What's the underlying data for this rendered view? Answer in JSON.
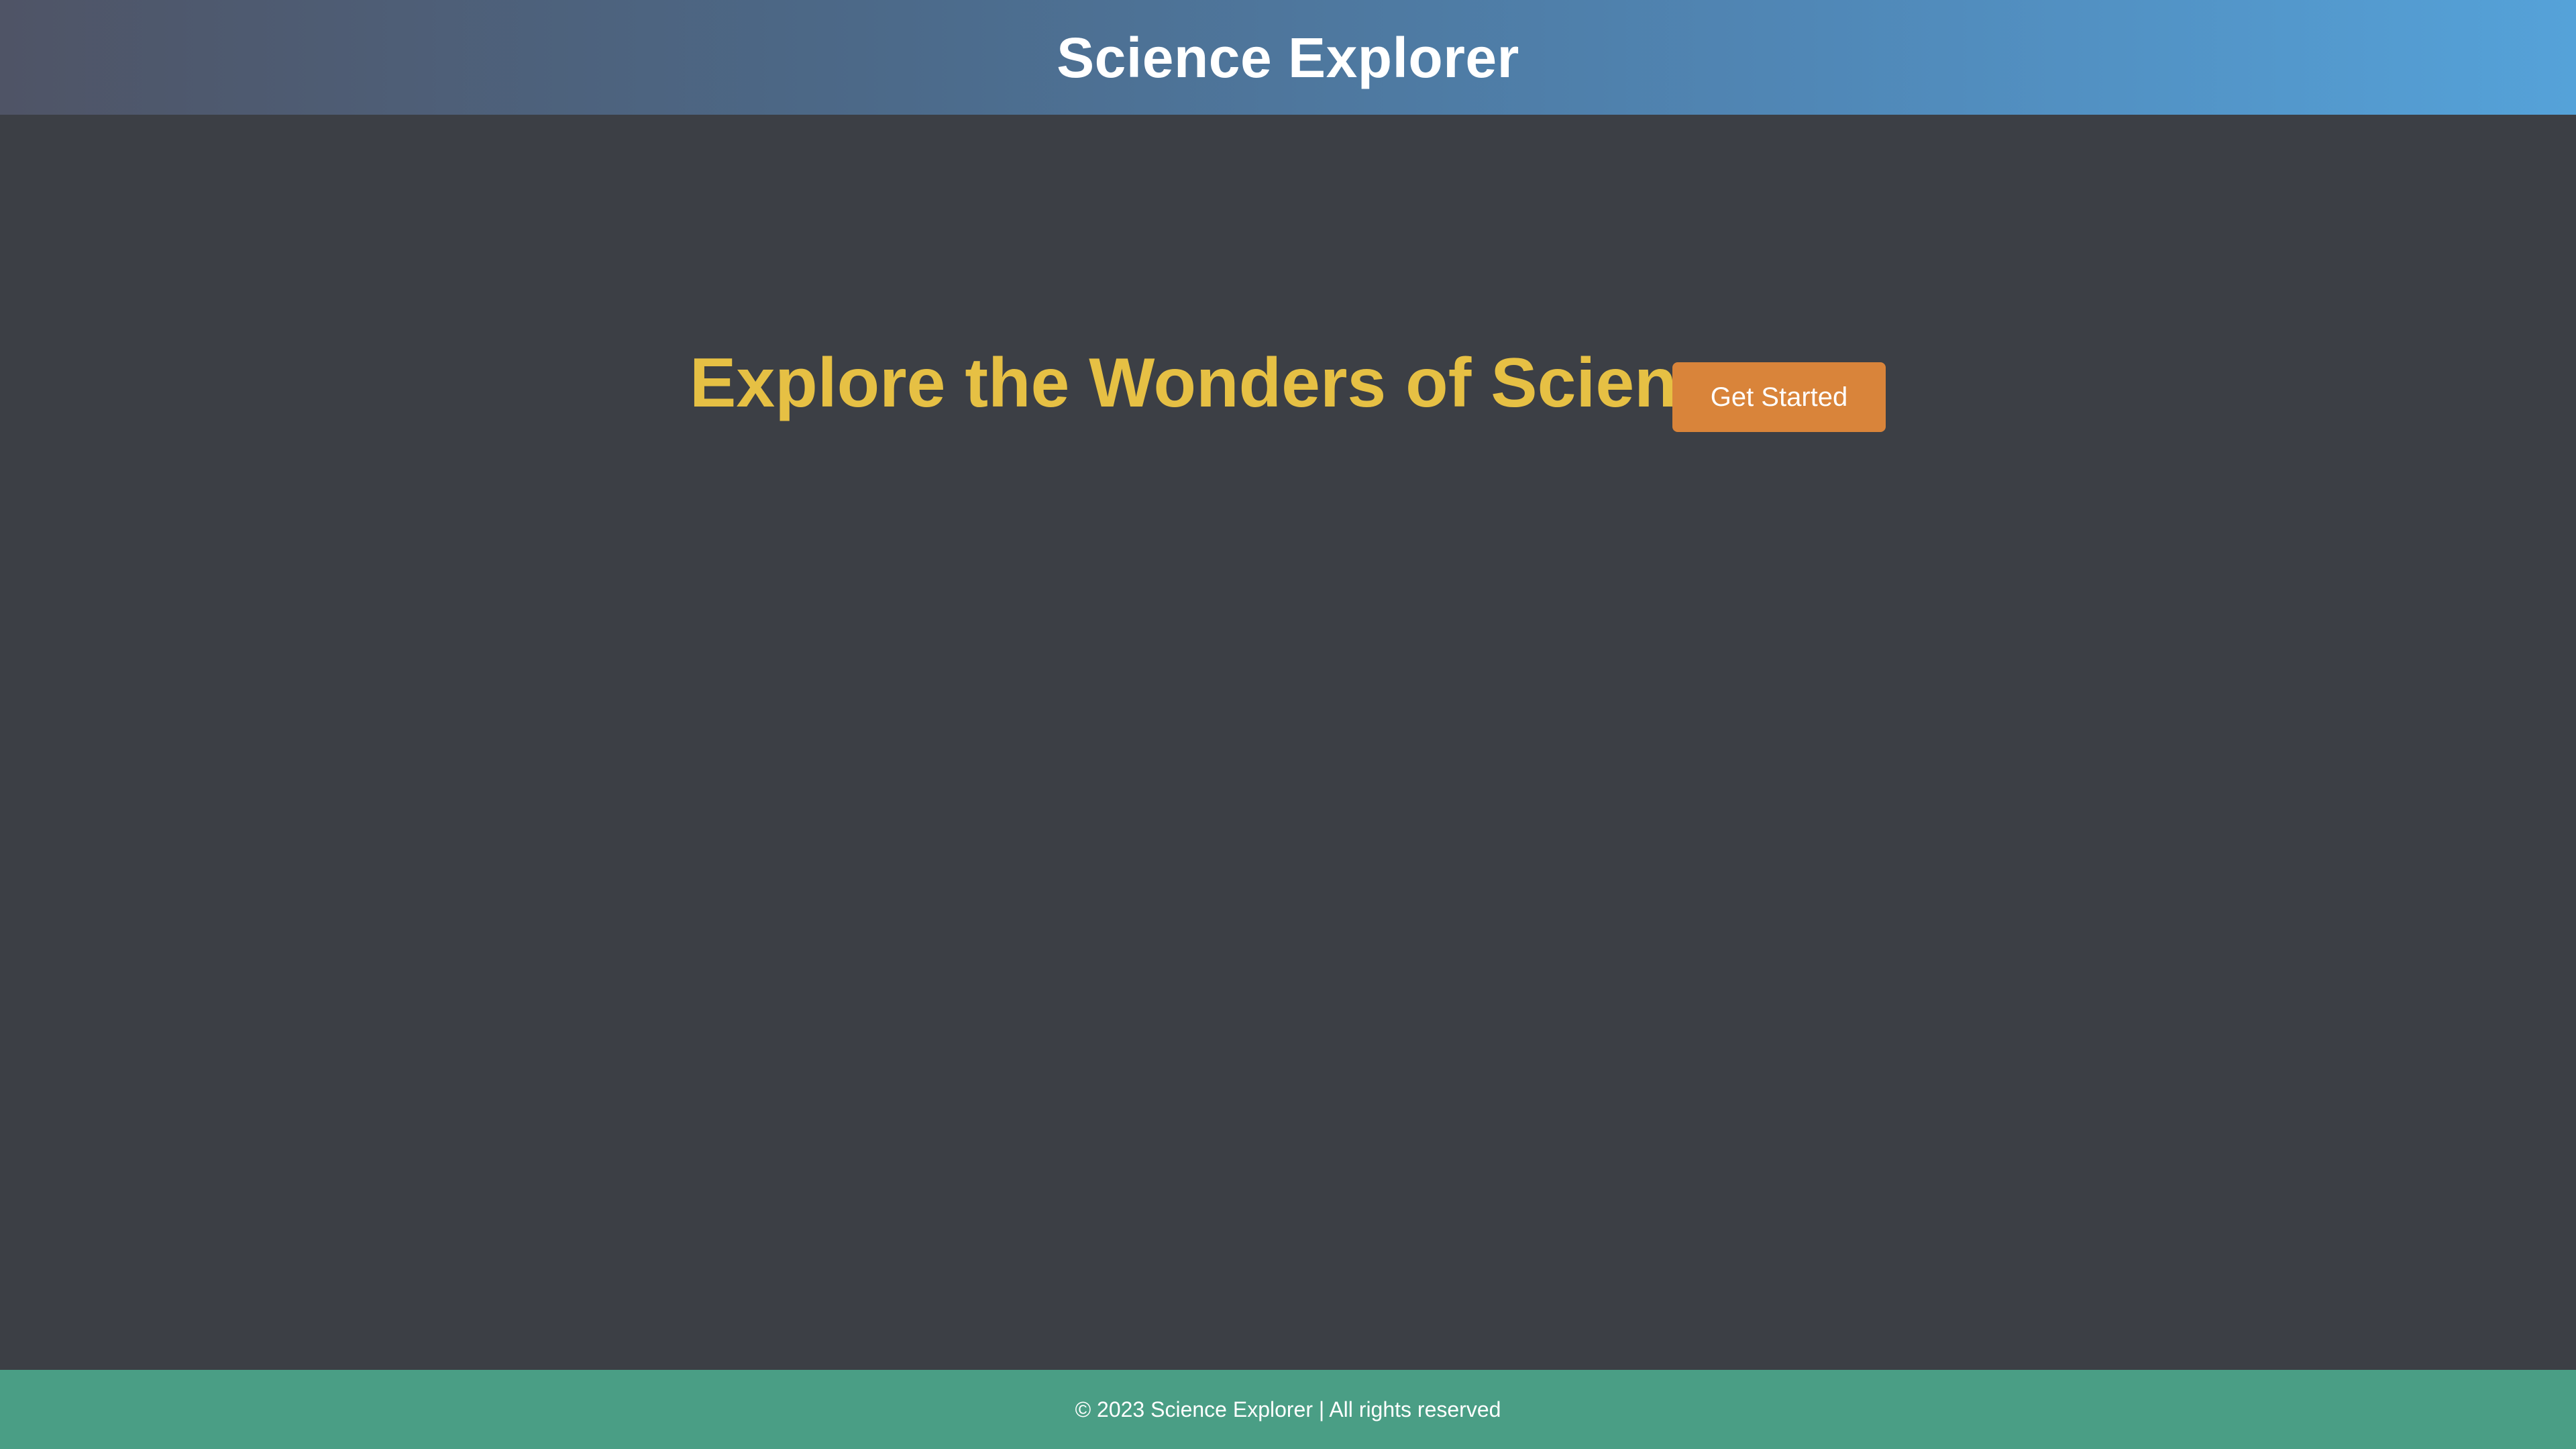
{
  "header": {
    "title": "Science Explorer"
  },
  "hero": {
    "heading": "Explore the Wonders of Science",
    "cta_label": "Get Started"
  },
  "footer": {
    "copyright": "© 2023 Science Explorer | All rights reserved"
  },
  "colors": {
    "header_gradient_start": "#4f5466",
    "header_gradient_end": "#55a2d9",
    "background": "#3c3f45",
    "heading": "#e6c044",
    "button": "#d9843a",
    "footer": "#4a9e85",
    "text_light": "#ffffff"
  }
}
